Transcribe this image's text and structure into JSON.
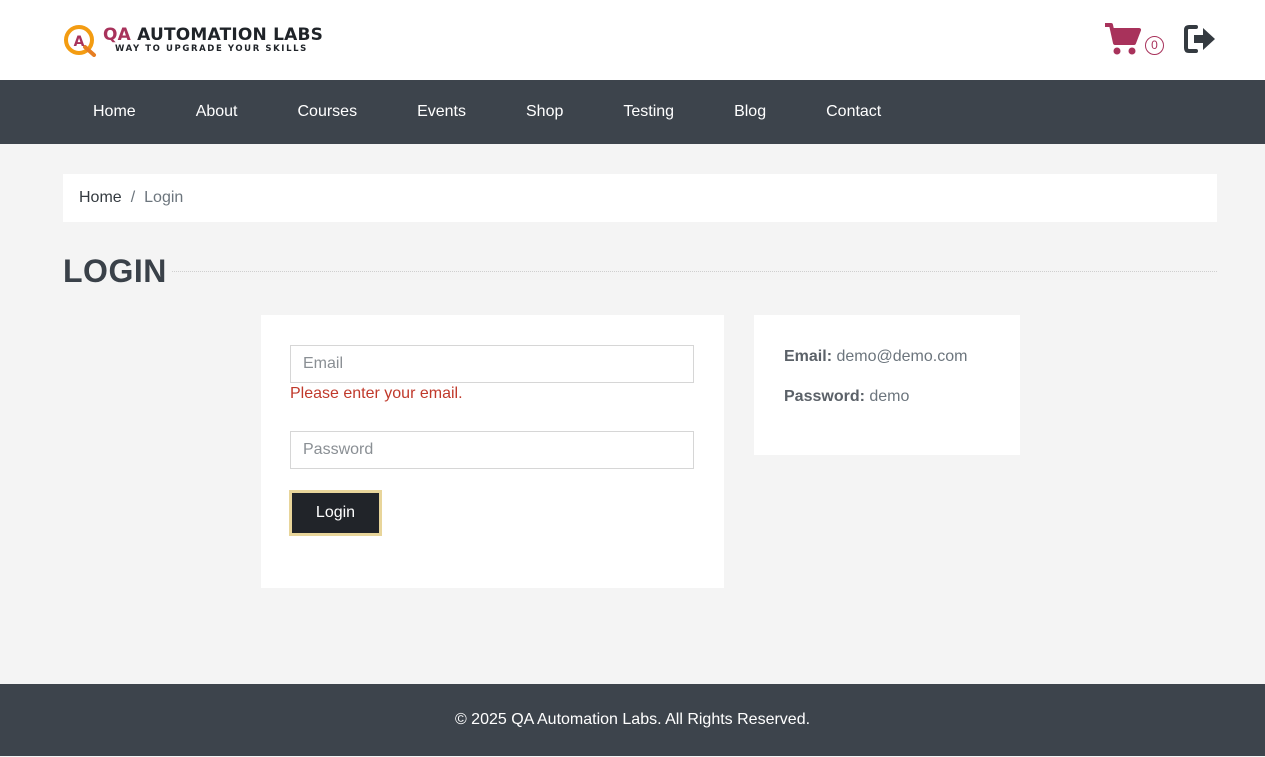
{
  "header": {
    "logo": {
      "mark_letter": "A",
      "title_highlight": "QA",
      "title_rest": " AUTOMATION LABS",
      "tagline": "WAY TO UPGRADE YOUR SKILLS"
    },
    "cart": {
      "icon": "cart-icon",
      "count": "0"
    },
    "logout": {
      "icon": "logout-icon"
    }
  },
  "nav": {
    "items": [
      {
        "label": "Home"
      },
      {
        "label": "About"
      },
      {
        "label": "Courses"
      },
      {
        "label": "Events"
      },
      {
        "label": "Shop"
      },
      {
        "label": "Testing"
      },
      {
        "label": "Blog"
      },
      {
        "label": "Contact"
      }
    ]
  },
  "breadcrumb": {
    "home": "Home",
    "separator": "/",
    "current": "Login"
  },
  "page": {
    "title": "LOGIN"
  },
  "form": {
    "email": {
      "value": "",
      "placeholder": "Email",
      "error": "Please enter your email."
    },
    "password": {
      "value": "",
      "placeholder": "Password"
    },
    "submit_label": "Login"
  },
  "credentials": {
    "email_label": "Email:",
    "email_value": " demo@demo.com",
    "password_label": "Password:",
    "password_value": " demo"
  },
  "footer": {
    "copyright": "© 2025 QA Automation Labs. All Rights Reserved."
  },
  "colors": {
    "brand": "#a8325b",
    "nav_bg": "#3d444c",
    "error": "#c0392b",
    "button_bg": "#212429",
    "button_focus": "#e8d59a"
  }
}
